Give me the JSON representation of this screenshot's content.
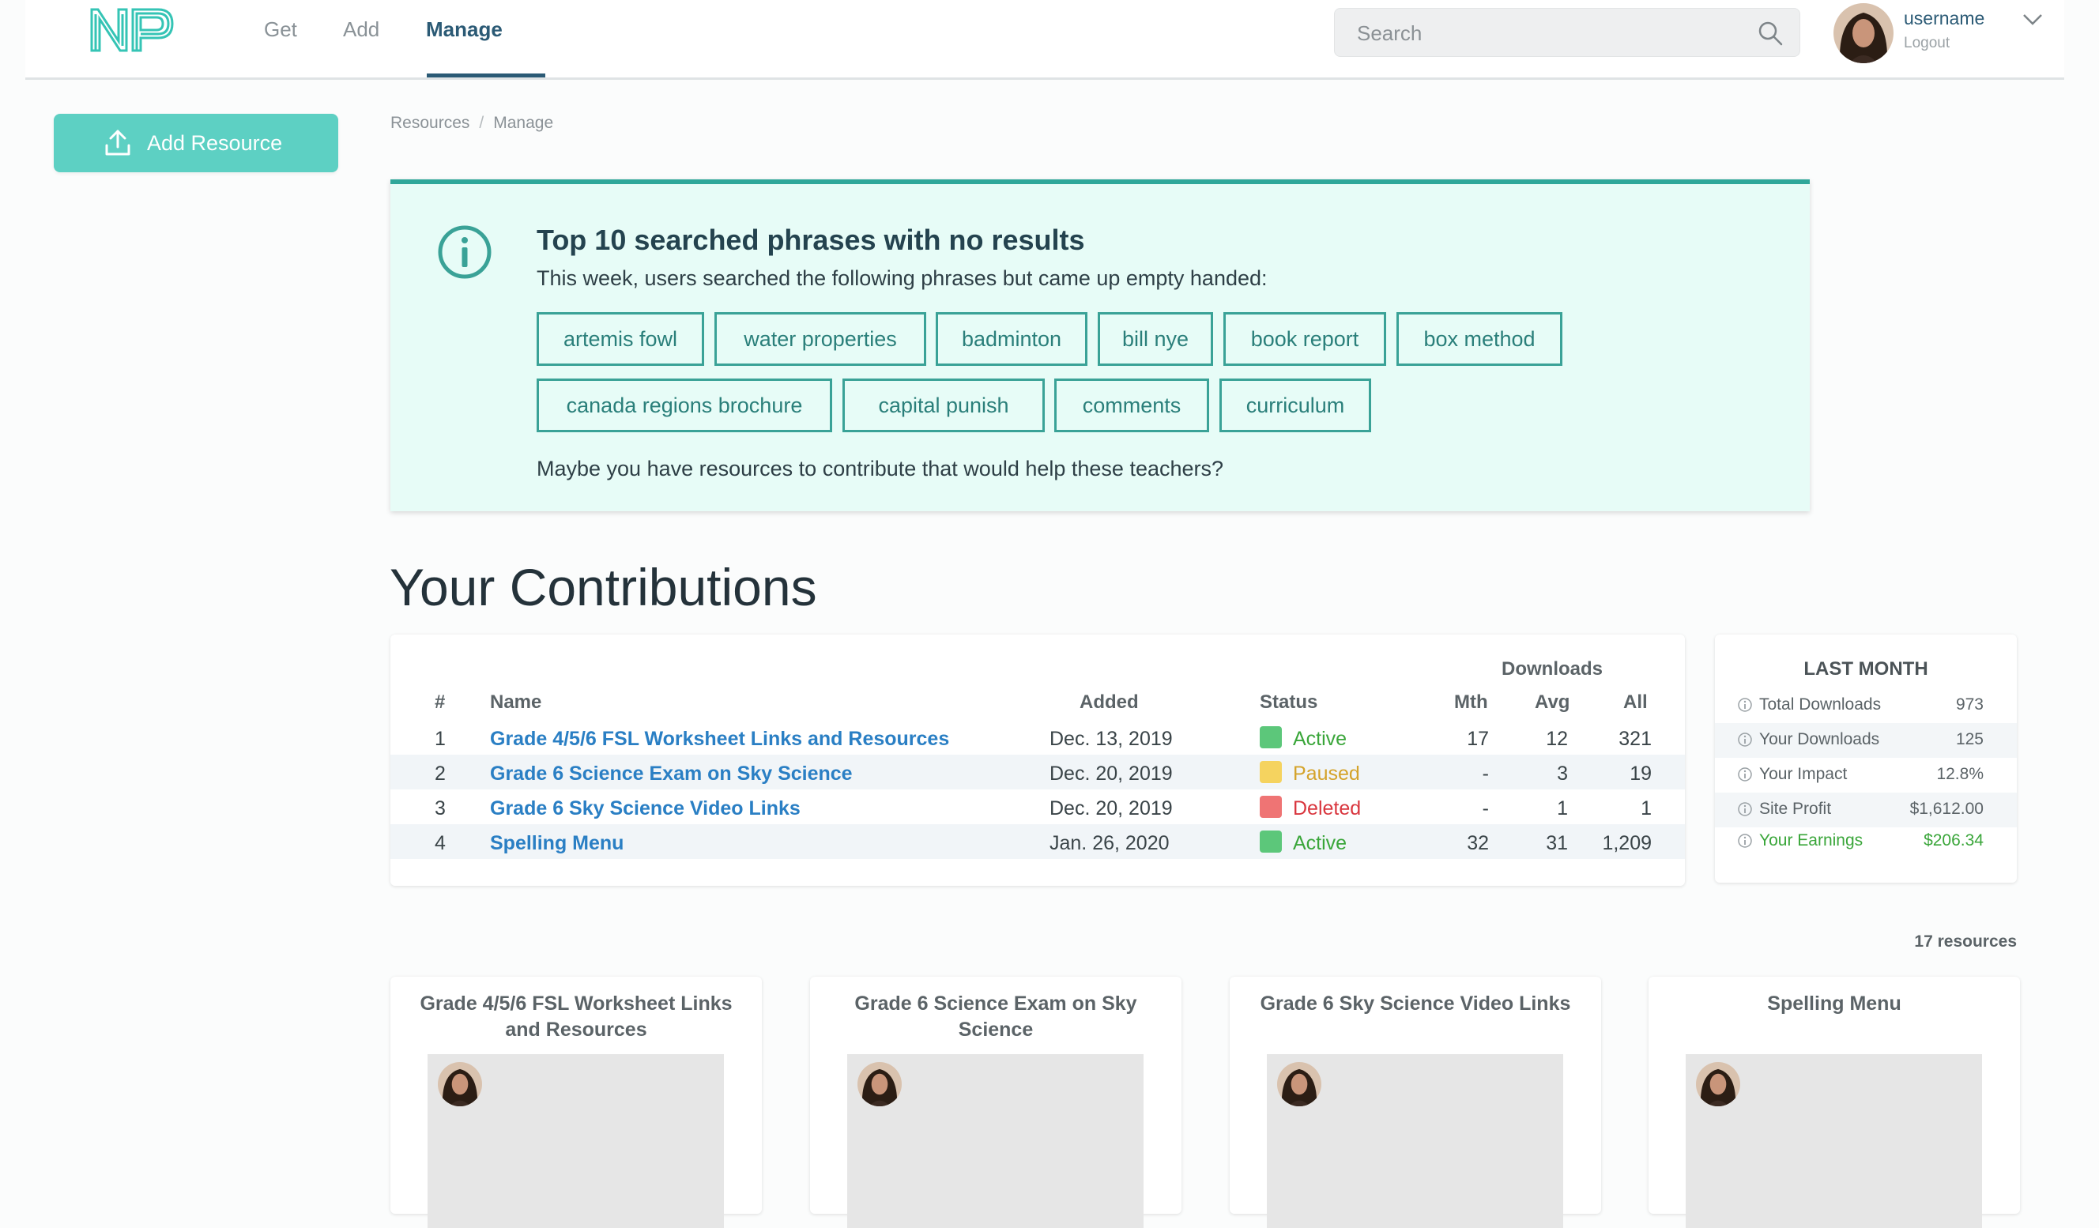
{
  "header": {
    "logo_text": "NP",
    "nav": [
      {
        "label": "Get",
        "active": false
      },
      {
        "label": "Add",
        "active": false
      },
      {
        "label": "Manage",
        "active": true
      }
    ],
    "search_placeholder": "Search",
    "user": {
      "name": "username",
      "logout_label": "Logout"
    }
  },
  "sidebar": {
    "add_resource_label": "Add Resource"
  },
  "breadcrumb": {
    "items": [
      "Resources",
      "Manage"
    ],
    "separator": "/"
  },
  "info_panel": {
    "title": "Top 10 searched phrases with no results",
    "subtitle": "This week, users searched the following phrases but came up empty handed:",
    "phrases": [
      "artemis fowl",
      "water properties",
      "badminton",
      "bill nye",
      "book report",
      "box method",
      "canada regions brochure",
      "capital punish",
      "comments",
      "curriculum"
    ],
    "footer": "Maybe you have resources to contribute that would help these teachers?"
  },
  "contributions": {
    "title": "Your Contributions",
    "headers": {
      "index": "#",
      "name": "Name",
      "added": "Added",
      "status": "Status",
      "downloads": "Downloads",
      "mth": "Mth",
      "avg": "Avg",
      "all": "All"
    },
    "rows": [
      {
        "index": "1",
        "name": "Grade 4/5/6 FSL Worksheet Links and Resources",
        "added": "Dec. 13, 2019",
        "status": "Active",
        "status_color": "#5cc77a",
        "mth": "17",
        "avg": "12",
        "all": "321"
      },
      {
        "index": "2",
        "name": "Grade 6 Science Exam on Sky Science",
        "added": "Dec. 20, 2019",
        "status": "Paused",
        "status_color": "#f5d35f",
        "mth": "-",
        "avg": "3",
        "all": "19"
      },
      {
        "index": "3",
        "name": "Grade 6 Sky Science Video Links",
        "added": "Dec. 20, 2019",
        "status": "Deleted",
        "status_color": "#ef7474",
        "mth": "-",
        "avg": "1",
        "all": "1"
      },
      {
        "index": "4",
        "name": "Spelling Menu",
        "added": "Jan. 26, 2020",
        "status": "Active",
        "status_color": "#5cc77a",
        "mth": "32",
        "avg": "31",
        "all": "1,209"
      }
    ]
  },
  "last_month": {
    "title": "LAST MONTH",
    "rows": [
      {
        "label": "Total Downloads",
        "value": "973"
      },
      {
        "label": "Your Downloads",
        "value": "125"
      },
      {
        "label": "Your Impact",
        "value": "12.8%"
      },
      {
        "label": "Site Profit",
        "value": "$1,612.00"
      },
      {
        "label": "Your Earnings",
        "value": "$206.34"
      }
    ]
  },
  "resource_count": "17 resources",
  "resource_cards": [
    {
      "title": "Grade 4/5/6 FSL Worksheet Links and Resources"
    },
    {
      "title": "Grade 6 Science Exam on Sky Science"
    },
    {
      "title": "Grade 6 Sky Science Video Links"
    },
    {
      "title": "Spelling Menu"
    }
  ],
  "colors": {
    "accent": "#5dd0c3",
    "teal_dark": "#2fa79a",
    "link": "#2a7fc4",
    "nav_active": "#2b5a75",
    "active": "#5cc77a",
    "paused": "#f5d35f",
    "deleted": "#ef7474",
    "earnings": "#3aa63a"
  }
}
